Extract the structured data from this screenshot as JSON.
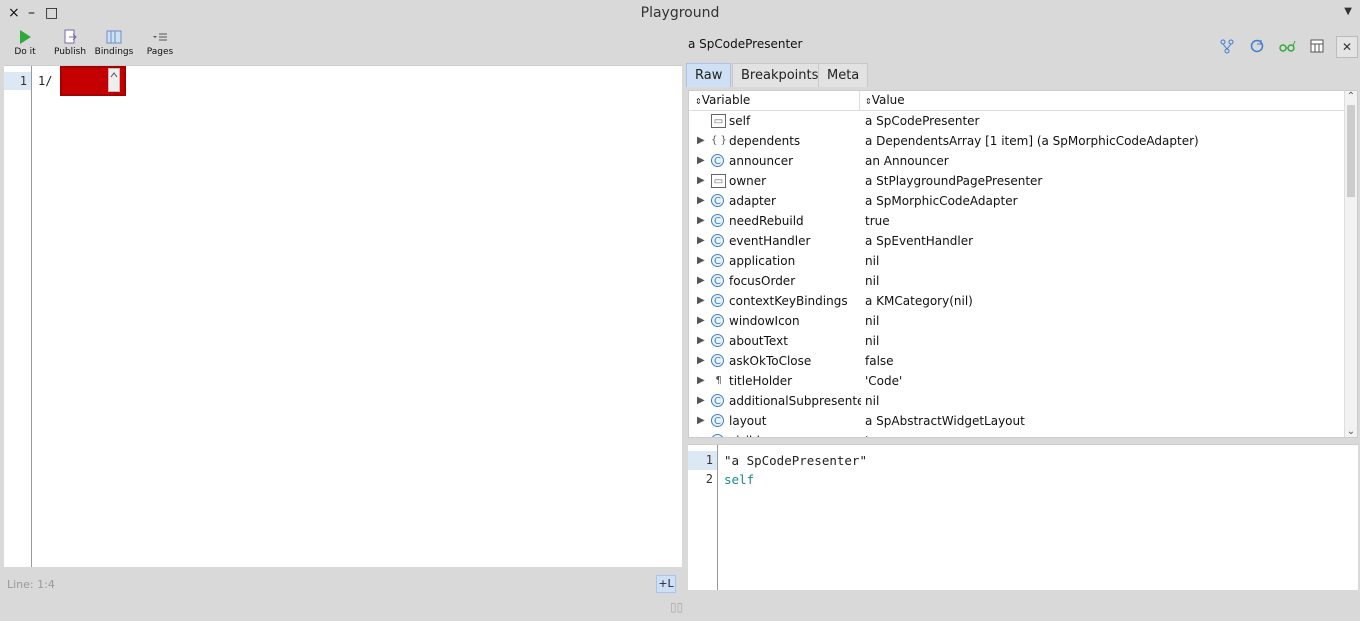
{
  "window": {
    "title": "Playground",
    "controls": [
      "×",
      "–",
      "□"
    ],
    "menu": "▼"
  },
  "toolbar": {
    "do_it": "Do it",
    "publish": "Publish",
    "bindings": "Bindings",
    "pages": "Pages"
  },
  "editor": {
    "line_number": "1",
    "code": "1/",
    "status": "Line: 1:4",
    "plus_l": "+L"
  },
  "inspector": {
    "title": "a SpCodePresenter",
    "tabs": [
      "Raw",
      "Breakpoints",
      "Meta"
    ],
    "columns": {
      "variable": "Variable",
      "value": "Value"
    },
    "rows": [
      {
        "name": "self",
        "value": "a SpCodePresenter",
        "icon": "window-icon",
        "expandable": false
      },
      {
        "name": "dependents",
        "value": "a DependentsArray [1 item] (a SpMorphicCodeAdapter)",
        "icon": "braces-icon",
        "expandable": true
      },
      {
        "name": "announcer",
        "value": "an Announcer",
        "icon": "class-icon",
        "expandable": true
      },
      {
        "name": "owner",
        "value": "a StPlaygroundPagePresenter",
        "icon": "window-icon",
        "expandable": true
      },
      {
        "name": "adapter",
        "value": "a SpMorphicCodeAdapter",
        "icon": "class-icon",
        "expandable": true
      },
      {
        "name": "needRebuild",
        "value": "true",
        "icon": "class-icon",
        "expandable": true
      },
      {
        "name": "eventHandler",
        "value": "a SpEventHandler",
        "icon": "class-icon",
        "expandable": true
      },
      {
        "name": "application",
        "value": "nil",
        "icon": "class-icon",
        "expandable": true
      },
      {
        "name": "focusOrder",
        "value": "nil",
        "icon": "class-icon",
        "expandable": true
      },
      {
        "name": "contextKeyBindings",
        "value": "a KMCategory(nil)",
        "icon": "class-icon",
        "expandable": true
      },
      {
        "name": "windowIcon",
        "value": "nil",
        "icon": "class-icon",
        "expandable": true
      },
      {
        "name": "aboutText",
        "value": "nil",
        "icon": "class-icon",
        "expandable": true
      },
      {
        "name": "askOkToClose",
        "value": "false",
        "icon": "class-icon",
        "expandable": true
      },
      {
        "name": "titleHolder",
        "value": "'Code'",
        "icon": "pilcrow-icon",
        "expandable": true
      },
      {
        "name": "additionalSubpresenters",
        "value": "nil",
        "icon": "class-icon",
        "expandable": true
      },
      {
        "name": "layout",
        "value": "a SpAbstractWidgetLayout",
        "icon": "class-icon",
        "expandable": true
      },
      {
        "name": "visible",
        "value": "true",
        "icon": "class-icon",
        "expandable": true
      }
    ]
  },
  "eval_editor": {
    "lines": [
      {
        "num": "1",
        "text": "\"a SpCodePresenter\"",
        "color": "#222222"
      },
      {
        "num": "2",
        "text": "self",
        "color": "#1a8a8a"
      }
    ]
  },
  "colors": {
    "accent": "#cfe0f5",
    "redaction": "#c40000",
    "class_icon": "#3a7fd0"
  }
}
